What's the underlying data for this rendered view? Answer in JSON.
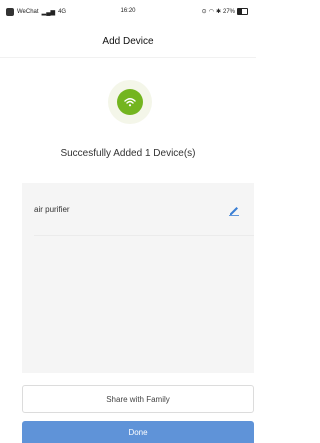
{
  "status_bar": {
    "carrier": "WeChat",
    "network": "4G",
    "time": "16:20",
    "battery": "27%"
  },
  "header": {
    "title": "Add Device"
  },
  "result": {
    "message": "Succesfully Added 1 Device(s)",
    "icon": "wifi-icon",
    "icon_color": "#73b51f"
  },
  "devices": [
    {
      "name": "air purifier",
      "action_icon": "edit-icon"
    }
  ],
  "actions": {
    "share_label": "Share with Family",
    "done_label": "Done",
    "done_color": "#5f93d8"
  }
}
